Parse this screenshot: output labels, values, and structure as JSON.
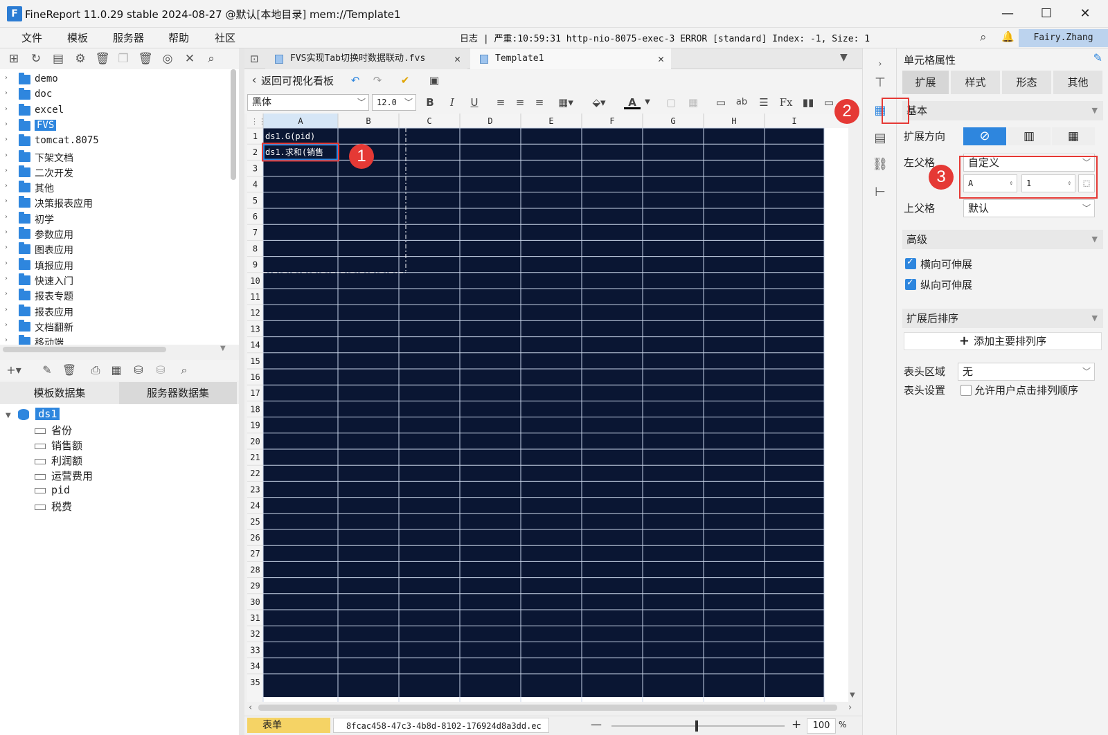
{
  "titlebar": {
    "title": "FineReport 11.0.29 stable 2024-08-27 @默认[本地目录]    mem://Template1"
  },
  "menu": {
    "items": [
      "文件",
      "模板",
      "服务器",
      "帮助",
      "社区"
    ],
    "log": "日志 | 严重:10:59:31 http-nio-8075-exec-3 ERROR [standard] Index: -1, Size: 1",
    "user": "Fairy.Zhang"
  },
  "tree": {
    "items": [
      "demo",
      "doc",
      "excel",
      "FVS",
      "tomcat.8075",
      "下架文档",
      "二次开发",
      "其他",
      "决策报表应用",
      "初学",
      "参数应用",
      "图表应用",
      "填报应用",
      "快速入门",
      "报表专题",
      "报表应用",
      "文档翻新",
      "移动端"
    ]
  },
  "datasets": {
    "tabs": [
      "模板数据集",
      "服务器数据集"
    ],
    "root": "ds1",
    "fields": [
      "省份",
      "销售额",
      "利润额",
      "运营费用",
      "pid",
      "税费"
    ]
  },
  "doctabs": {
    "tab1": "FVS实现Tab切换时数据联动.fvs",
    "tab2": "Template1"
  },
  "editor": {
    "back": "返回可视化看板",
    "font": "黑体",
    "size": "12.0"
  },
  "sheet": {
    "columns": [
      "A",
      "B",
      "C",
      "D",
      "E",
      "F",
      "G",
      "H",
      "I"
    ],
    "rows": [
      "1",
      "2",
      "3",
      "4",
      "5",
      "6",
      "7",
      "8",
      "9",
      "10",
      "11",
      "12",
      "13",
      "14",
      "15",
      "16",
      "17",
      "18",
      "19",
      "20",
      "21",
      "22",
      "23",
      "24",
      "25",
      "26",
      "27",
      "28",
      "29",
      "30",
      "31",
      "32",
      "33",
      "34",
      "35"
    ],
    "cells": {
      "A1": "ds1.G(pid)",
      "A2": "ds1.求和(销售"
    }
  },
  "status": {
    "sheet_tab": "表单",
    "file": "8fcac458-47c3-4b8d-8102-176924d8a3dd.ec",
    "zoom": "100",
    "pct": "%"
  },
  "props": {
    "title": "单元格属性",
    "tabs": [
      "扩展",
      "样式",
      "形态",
      "其他"
    ],
    "basic": "基本",
    "expand_dir_label": "扩展方向",
    "left_parent_label": "左父格",
    "left_parent_value": "自定义",
    "left_parent_col": "A",
    "left_parent_row": "1",
    "top_parent_label": "上父格",
    "top_parent_value": "默认",
    "advanced": "高级",
    "h_expand": "横向可伸展",
    "v_expand": "纵向可伸展",
    "sort_section": "扩展后排序",
    "add_sort": "添加主要排列序",
    "header_area_label": "表头区域",
    "header_area_value": "无",
    "header_set_label": "表头设置",
    "header_set_option": "允许用户点击排列顺序"
  },
  "badges": [
    "1",
    "2",
    "3"
  ],
  "colors": {
    "sheet_bg": "#0a1633",
    "accent": "#2e86de",
    "highlight": "#e53935"
  }
}
